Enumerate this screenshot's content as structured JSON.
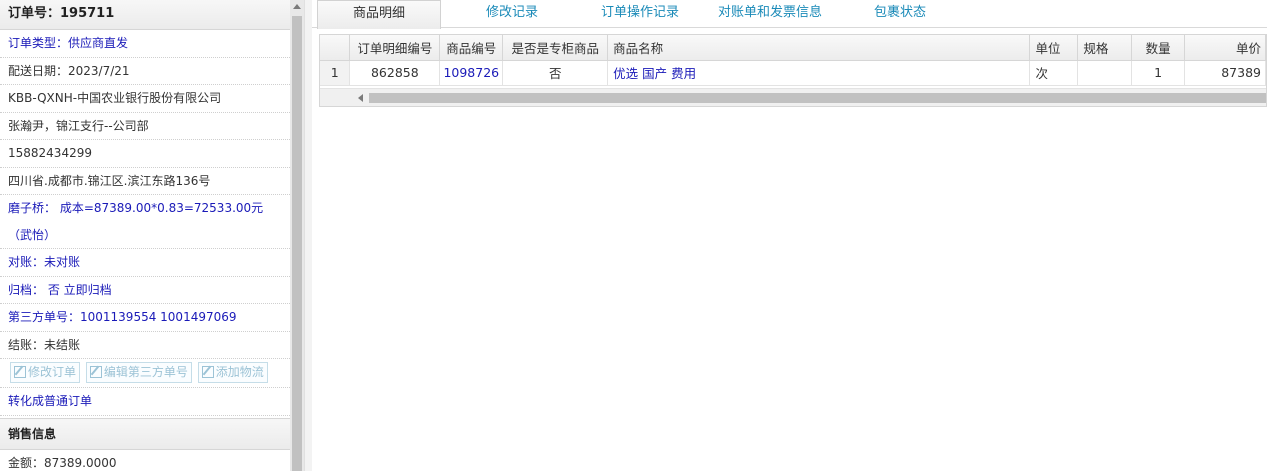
{
  "order": {
    "title": "订单号：195711",
    "type": "订单类型：供应商直发",
    "delivery_date": "配送日期：2023/7/21",
    "company": "KBB-QXNH-中国农业银行股份有限公司",
    "contact": "张瀚尹，锦江支行--公司部",
    "phone": "15882434299",
    "address": "四川省.成都市.锦江区.滨江东路136号",
    "cost": "磨子桥： 成本=87389.00*0.83=72533.00元（武怡）",
    "reconcile": "对账：未对账",
    "archive": "归档： 否 立即归档",
    "third_party": "第三方单号：1001139554 1001497069",
    "settlement": "结账：未结账",
    "convert_link": "转化成普通订单"
  },
  "buttons": {
    "modify_order": "修改订单",
    "edit_third_party": "编辑第三方单号",
    "add_logistics": "添加物流"
  },
  "sales": {
    "title": "销售信息",
    "amount": "金额：87389.0000"
  },
  "tabs": [
    {
      "label": "商品明细"
    },
    {
      "label": "修改记录"
    },
    {
      "label": "订单操作记录"
    },
    {
      "label": "对账单和发票信息"
    },
    {
      "label": "包裹状态"
    }
  ],
  "table": {
    "headers": [
      "订单明细编号",
      "商品编号",
      "是否是专柜商品",
      "商品名称",
      "单位",
      "规格",
      "数量",
      "单价"
    ],
    "rows": [
      {
        "num": "1",
        "detail_id": "862858",
        "product_id": "1098726",
        "counter": "否",
        "name": "优选 国产 费用",
        "unit": "次",
        "spec": "",
        "qty": "1",
        "price": "87389"
      }
    ]
  },
  "colors": {
    "link": "#1a1ab8",
    "tab": "#1a8ab8"
  },
  "icons": {
    "edit": "edit-icon",
    "up": "chevron-up-icon",
    "left": "chevron-left-icon"
  }
}
